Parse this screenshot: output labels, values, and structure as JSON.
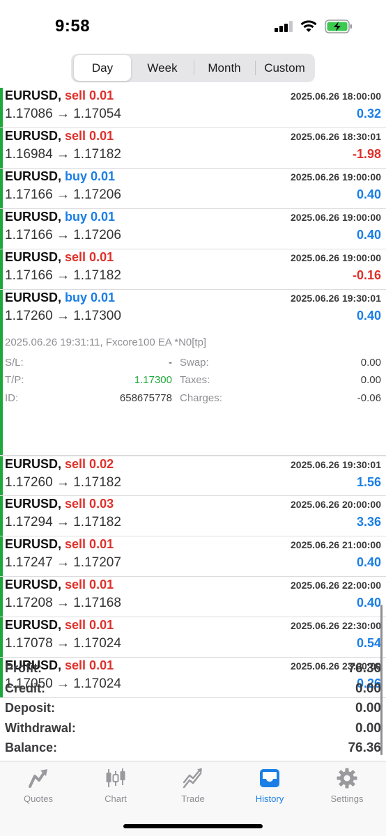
{
  "status": {
    "time": "9:58"
  },
  "segments": [
    "Day",
    "Week",
    "Month",
    "Custom"
  ],
  "deals": [
    {
      "symbol": "EURUSD,",
      "action": "sell 0.01",
      "side": "sell",
      "prices": "1.17086 → 1.17054",
      "time": "2025.06.26 18:00:00",
      "profit": "0.32",
      "sign": "pos"
    },
    {
      "symbol": "EURUSD,",
      "action": "sell 0.01",
      "side": "sell",
      "prices": "1.16984 → 1.17182",
      "time": "2025.06.26 18:30:01",
      "profit": "-1.98",
      "sign": "neg"
    },
    {
      "symbol": "EURUSD,",
      "action": "buy 0.01",
      "side": "buy",
      "prices": "1.17166 → 1.17206",
      "time": "2025.06.26 19:00:00",
      "profit": "0.40",
      "sign": "pos"
    },
    {
      "symbol": "EURUSD,",
      "action": "buy 0.01",
      "side": "buy",
      "prices": "1.17166 → 1.17206",
      "time": "2025.06.26 19:00:00",
      "profit": "0.40",
      "sign": "pos"
    },
    {
      "symbol": "EURUSD,",
      "action": "sell 0.01",
      "side": "sell",
      "prices": "1.17166 → 1.17182",
      "time": "2025.06.26 19:00:00",
      "profit": "-0.16",
      "sign": "neg"
    },
    {
      "symbol": "EURUSD,",
      "action": "buy 0.01",
      "side": "buy",
      "prices": "1.17260 → 1.17300",
      "time": "2025.06.26 19:30:01",
      "profit": "0.40",
      "sign": "pos"
    }
  ],
  "details": {
    "comment": "2025.06.26 19:31:11, Fxcore100 EA *N0[tp]",
    "sl_label": "S/L:",
    "sl_value": "-",
    "tp_label": "T/P:",
    "tp_value": "1.17300",
    "id_label": "ID:",
    "id_value": "658675778",
    "swap_label": "Swap:",
    "swap_value": "0.00",
    "taxes_label": "Taxes:",
    "taxes_value": "0.00",
    "charges_label": "Charges:",
    "charges_value": "-0.06"
  },
  "deals2": [
    {
      "symbol": "EURUSD,",
      "action": "sell 0.02",
      "side": "sell",
      "prices": "1.17260 → 1.17182",
      "time": "2025.06.26 19:30:01",
      "profit": "1.56",
      "sign": "pos"
    },
    {
      "symbol": "EURUSD,",
      "action": "sell 0.03",
      "side": "sell",
      "prices": "1.17294 → 1.17182",
      "time": "2025.06.26 20:00:00",
      "profit": "3.36",
      "sign": "pos"
    },
    {
      "symbol": "EURUSD,",
      "action": "sell 0.01",
      "side": "sell",
      "prices": "1.17247 → 1.17207",
      "time": "2025.06.26 21:00:00",
      "profit": "0.40",
      "sign": "pos"
    },
    {
      "symbol": "EURUSD,",
      "action": "sell 0.01",
      "side": "sell",
      "prices": "1.17208 → 1.17168",
      "time": "2025.06.26 22:00:00",
      "profit": "0.40",
      "sign": "pos"
    },
    {
      "symbol": "EURUSD,",
      "action": "sell 0.01",
      "side": "sell",
      "prices": "1.17078 → 1.17024",
      "time": "2025.06.26 22:30:00",
      "profit": "0.54",
      "sign": "pos"
    },
    {
      "symbol": "EURUSD,",
      "action": "sell 0.01",
      "side": "sell",
      "prices": "1.17050 → 1.17024",
      "time": "2025.06.26 23:00:00",
      "profit": "0.26",
      "sign": "pos"
    }
  ],
  "summary": [
    {
      "label": "Profit:",
      "value": "76.36"
    },
    {
      "label": "Credit:",
      "value": "0.00"
    },
    {
      "label": "Deposit:",
      "value": "0.00"
    },
    {
      "label": "Withdrawal:",
      "value": "0.00"
    },
    {
      "label": "Balance:",
      "value": "76.36"
    }
  ],
  "tabs": [
    "Quotes",
    "Chart",
    "Trade",
    "History",
    "Settings"
  ],
  "colors": {
    "sell": "#e0302a",
    "buy": "#1a7ee6",
    "accent": "#1a7ee6",
    "indicator": "#1fa83a"
  }
}
